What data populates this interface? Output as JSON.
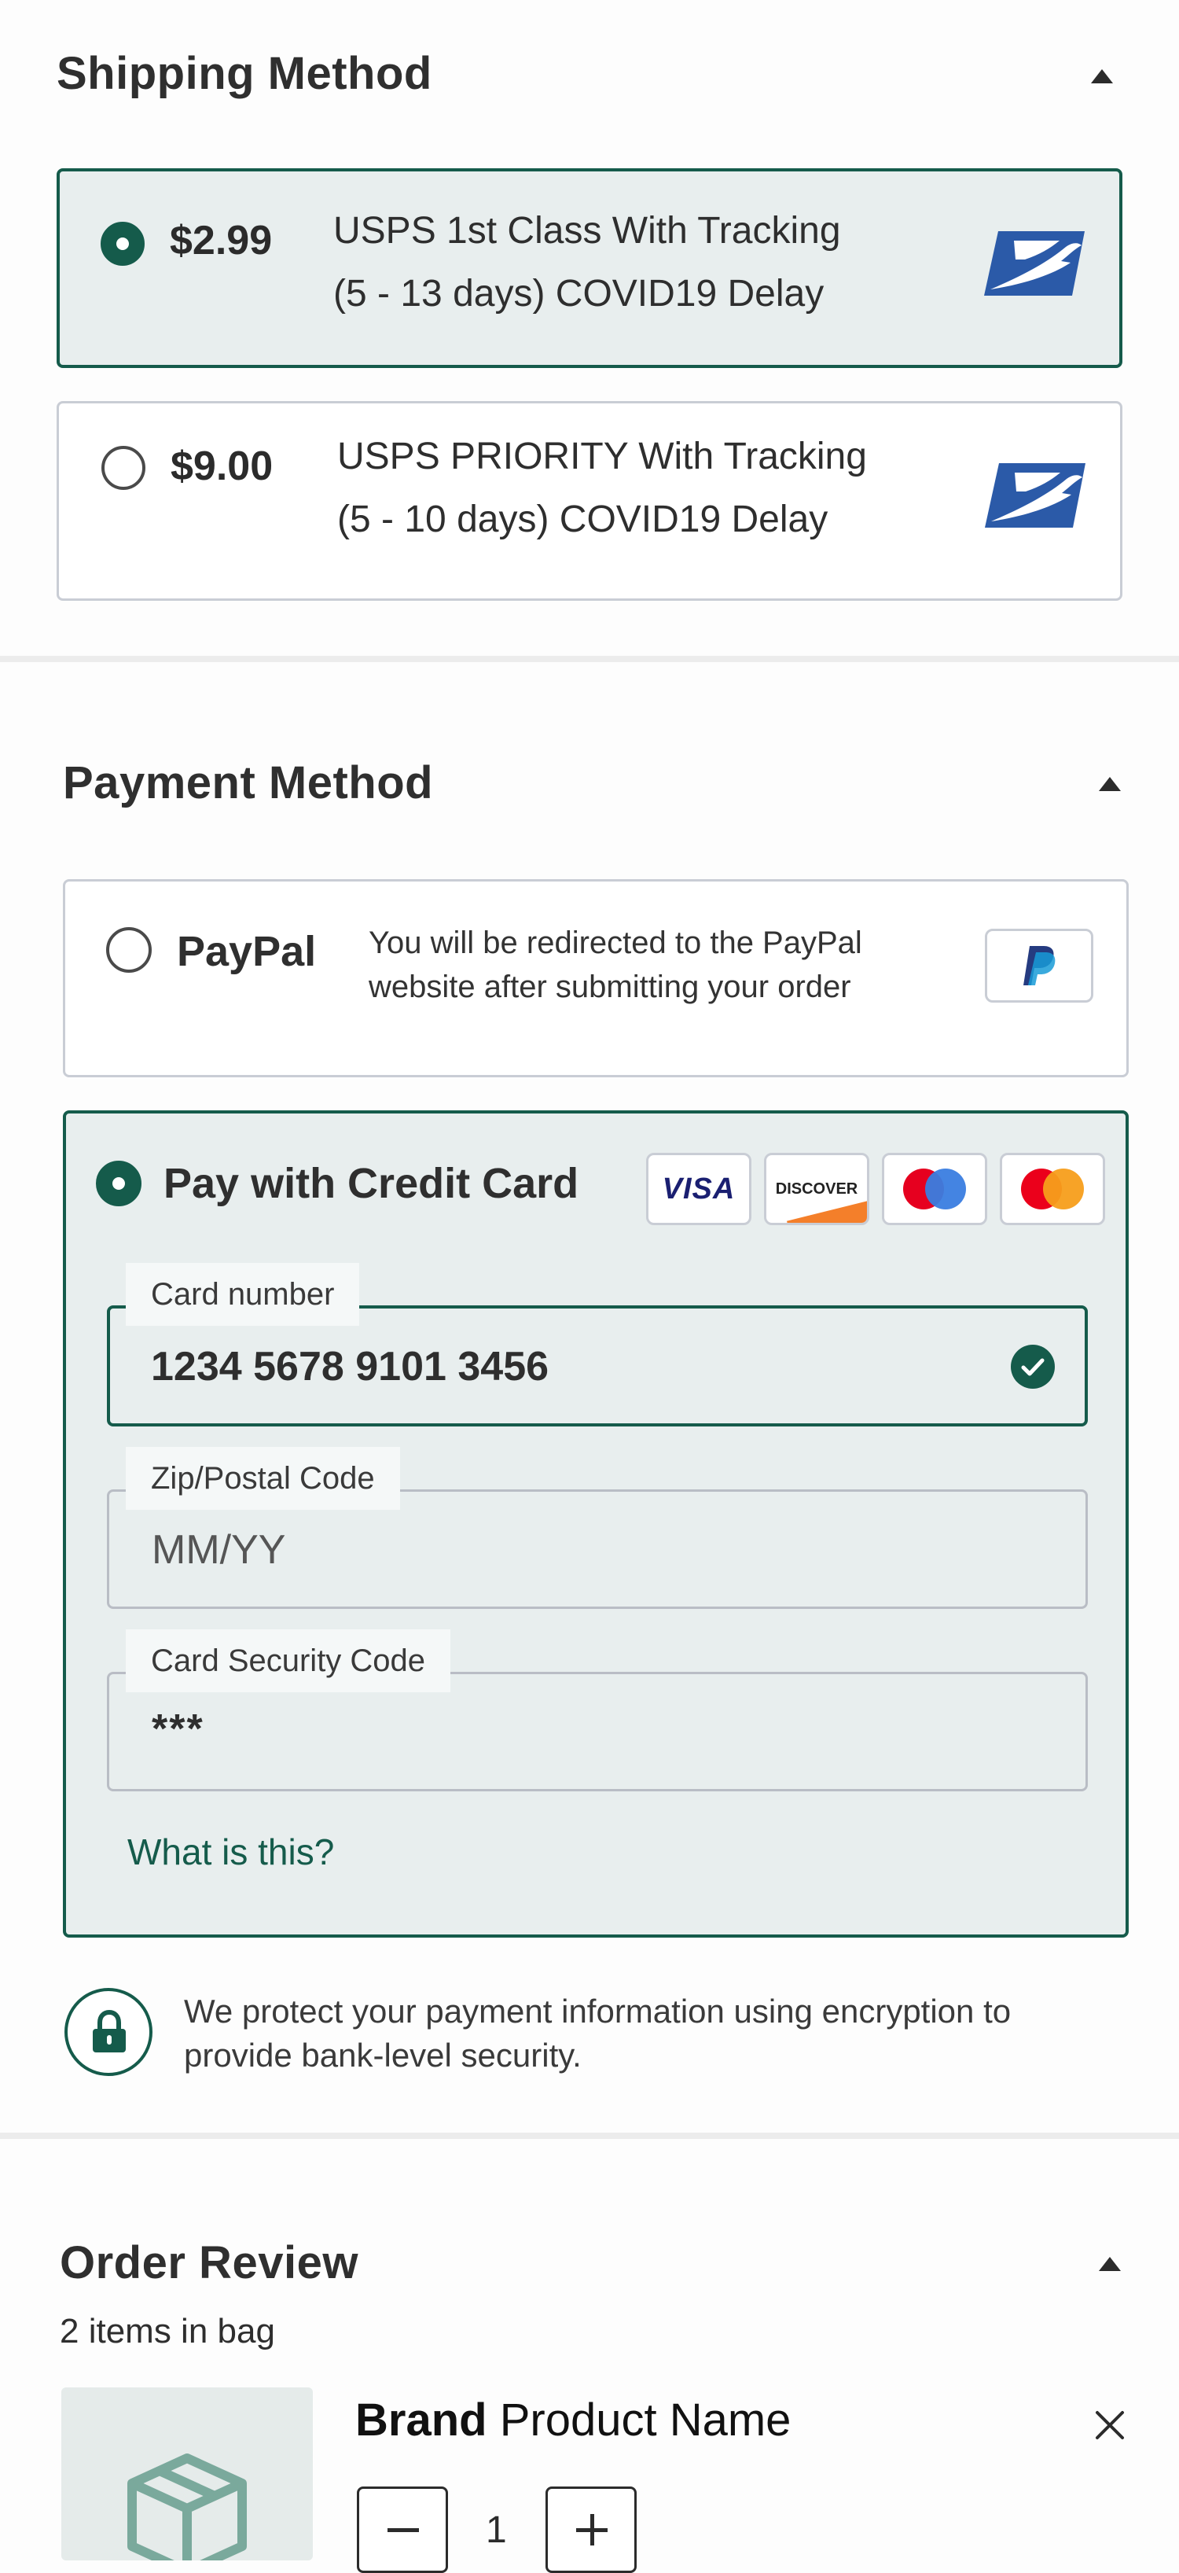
{
  "shipping": {
    "title": "Shipping Method",
    "options": [
      {
        "price": "$2.99",
        "line1": "USPS 1st Class With Tracking",
        "line2": "(5 - 13 days) COVID19 Delay",
        "selected": true,
        "icon": "usps-eagle-logo"
      },
      {
        "price": "$9.00",
        "line1": "USPS PRIORITY With Tracking",
        "line2": "(5 - 10 days) COVID19 Delay",
        "selected": false,
        "icon": "usps-eagle-logo"
      }
    ]
  },
  "payment": {
    "title": "Payment Method",
    "paypal": {
      "label": "PayPal",
      "desc_line1": "You will be redirected to the PayPal",
      "desc_line2": "website after submitting your order",
      "icon": "paypal-logo",
      "selected": false
    },
    "credit": {
      "label": "Pay with Credit Card",
      "selected": true,
      "card_brands": [
        {
          "name": "visa",
          "text": "VISA"
        },
        {
          "name": "discover",
          "text": "DISCOVER"
        },
        {
          "name": "maestro",
          "text": ""
        },
        {
          "name": "mastercard",
          "text": ""
        }
      ],
      "fields": [
        {
          "label": "Card number",
          "value": "1234 5678 9101 3456",
          "valid": true
        },
        {
          "label": "Zip/Postal Code",
          "placeholder": "MM/YY"
        },
        {
          "label": "Card Security Code",
          "value": "***"
        }
      ],
      "help_link": "What is this?"
    },
    "security_note_line1": "We protect your payment information using encryption to",
    "security_note_line2": "provide bank-level security.",
    "security_icon": "lock-icon"
  },
  "order": {
    "title": "Order Review",
    "count": "2 items in bag",
    "item": {
      "brand": "Brand",
      "name": "Product Name",
      "quantity": "1",
      "image_icon": "box-icon"
    }
  },
  "colors": {
    "accent": "#155b4b",
    "selected_bg": "#e8eeee",
    "border": "#c9cdd5",
    "usps_blue": "#2b5aa8"
  }
}
